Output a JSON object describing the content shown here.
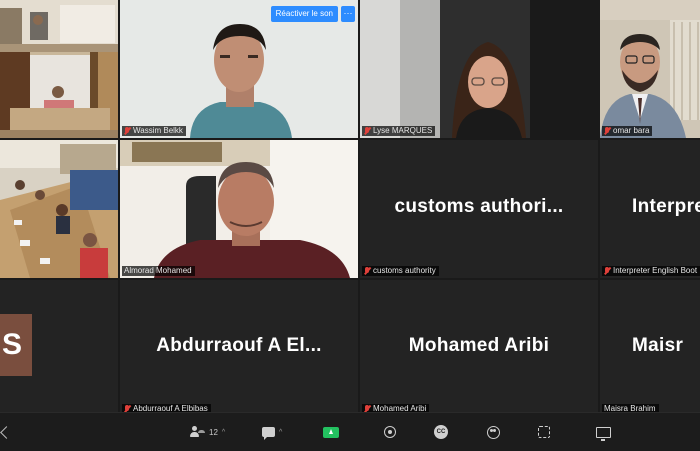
{
  "meeting": {
    "unmute_banner": "Réactiver le son",
    "more_symbol": "···",
    "participants": [
      {
        "id": "room-top",
        "label": "",
        "muted": false
      },
      {
        "id": "wassim",
        "label": "Wassim Belkk",
        "muted": true
      },
      {
        "id": "lyse",
        "label": "Lyse MARQUES",
        "muted": true
      },
      {
        "id": "omar",
        "label": "omar bara",
        "muted": true
      },
      {
        "id": "room-bottom",
        "label": "",
        "muted": false
      },
      {
        "id": "almorad",
        "label": "Almorad Mohamed",
        "muted": false,
        "active_speaker": true
      },
      {
        "id": "customs",
        "label": "customs authority",
        "display_name": "customs  authori...",
        "muted": true
      },
      {
        "id": "interpreter",
        "label": "Interpreter English Boot",
        "display_name": "Interpre",
        "muted": true
      },
      {
        "id": "s-user",
        "label": "",
        "avatar_letter": "S",
        "avatar_color": "#7a4e3e"
      },
      {
        "id": "abdurraouf",
        "label": "Abdurraouf A Elbibas",
        "display_name": "Abdurraouf  A  El...",
        "muted": true
      },
      {
        "id": "aribi",
        "label": "Mohamed Aribi",
        "display_name": "Mohamed Aribi",
        "muted": true
      },
      {
        "id": "maisra",
        "label": "Maisra Brahim",
        "display_name": "Maisr",
        "muted": false
      }
    ]
  },
  "toolbar": {
    "participants_count": "12",
    "caret": "^",
    "items": [
      "participants-icon",
      "chat-icon",
      "share-screen-icon",
      "record-icon",
      "captions-icon",
      "reactions-icon",
      "apps-icon",
      "whiteboard-icon"
    ],
    "cc_text": "CC",
    "colors": {
      "share": "#23c160",
      "accent": "#2d8cff",
      "active_border": "#c7e84b",
      "muted_mic": "#e0403a"
    }
  }
}
